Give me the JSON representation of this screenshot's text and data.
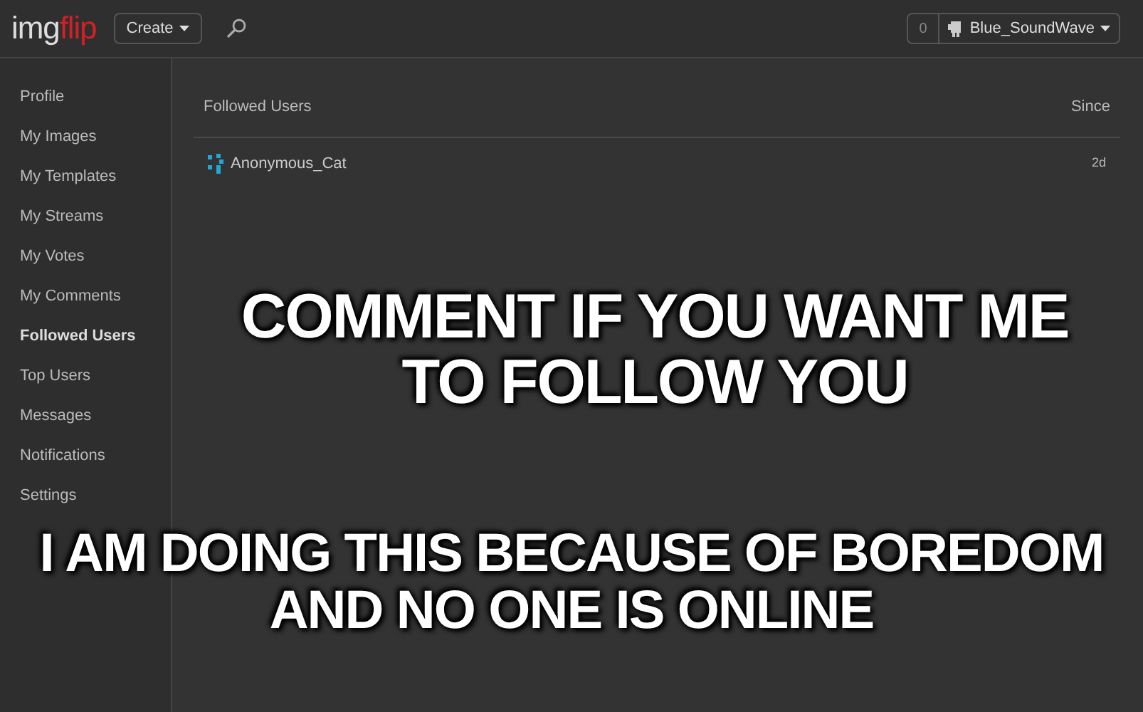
{
  "header": {
    "logo": {
      "part_1": "img",
      "part_2": "flip"
    },
    "create_button": "Create",
    "notification_count": "0",
    "username": "Blue_SoundWave"
  },
  "sidebar": {
    "items": [
      {
        "label": "Profile",
        "selected": false
      },
      {
        "label": "My Images",
        "selected": false
      },
      {
        "label": "My Templates",
        "selected": false
      },
      {
        "label": "My Streams",
        "selected": false
      },
      {
        "label": "My Votes",
        "selected": false
      },
      {
        "label": "My Comments",
        "selected": false
      },
      {
        "label": "Followed Users",
        "selected": true
      },
      {
        "label": "Top Users",
        "selected": false
      },
      {
        "label": "Messages",
        "selected": false
      },
      {
        "label": "Notifications",
        "selected": false
      },
      {
        "label": "Settings",
        "selected": false
      }
    ]
  },
  "table": {
    "columns": [
      "Followed Users",
      "Since"
    ],
    "rows": [
      {
        "user": "Anonymous_Cat",
        "since": "2d"
      }
    ]
  },
  "captions": [
    "COMMENT IF YOU WANT ME TO FOLLOW YOU",
    "I AM DOING THIS BECAUSE OF BOREDOM AND NO ONE IS ONLINE"
  ]
}
